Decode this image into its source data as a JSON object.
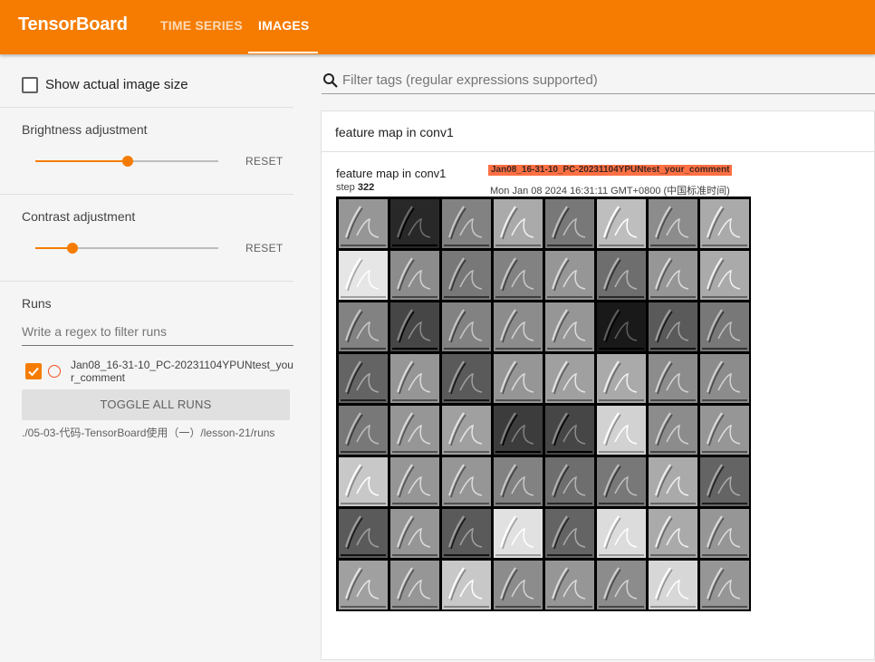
{
  "header": {
    "brand": "TensorBoard",
    "tabs": [
      {
        "label": "TIME SERIES",
        "active": false
      },
      {
        "label": "IMAGES",
        "active": true
      }
    ],
    "accent_color": "#f57c00"
  },
  "sidebar": {
    "show_actual_size": {
      "label": "Show actual image size",
      "checked": false
    },
    "brightness": {
      "title": "Brightness adjustment",
      "value": 0.5,
      "reset_label": "RESET"
    },
    "contrast": {
      "title": "Contrast adjustment",
      "value": 0.2,
      "reset_label": "RESET"
    },
    "runs": {
      "title": "Runs",
      "filter_placeholder": "Write a regex to filter runs",
      "items": [
        {
          "name": "Jan08_16-31-10_PC-20231104YPUNtest_your_comment",
          "checked": true,
          "color": "#f4511e"
        }
      ],
      "toggle_all_label": "TOGGLE ALL RUNS",
      "logdir": "./05-03-代码-TensorBoard使用（一）/lesson-21/runs"
    }
  },
  "main": {
    "filter_placeholder": "Filter tags (regular expressions supported)",
    "card": {
      "tag": "feature map in conv1",
      "image": {
        "title": "feature map in conv1",
        "step_label": "step",
        "step_value": "322",
        "run": "Jan08_16-31-10_PC-20231104YPUNtest_your_comment",
        "timestamp": "Mon Jan 08 2024 16:31:11 GMT+0800 (中国标准时间)"
      }
    }
  }
}
